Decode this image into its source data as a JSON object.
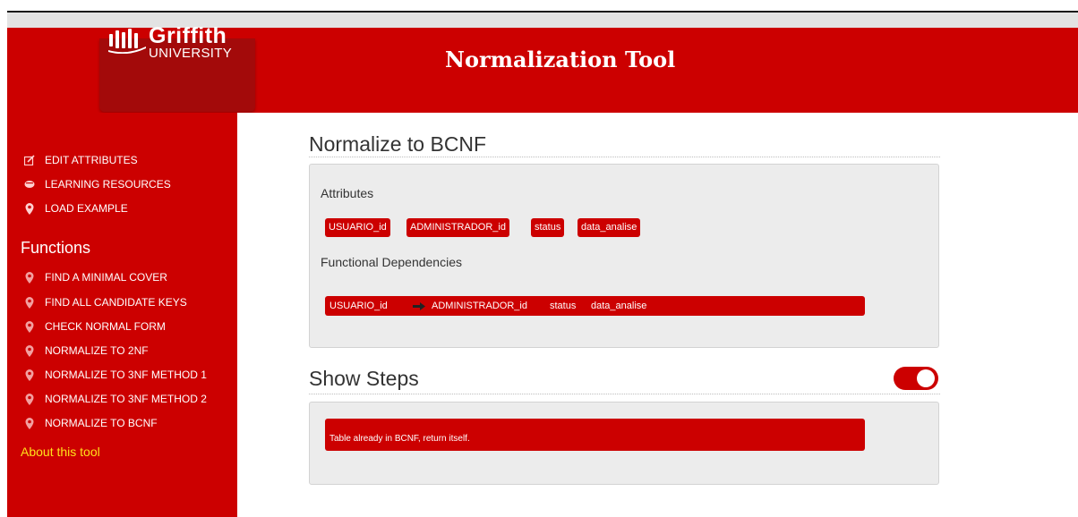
{
  "brand": {
    "logo_word": "Griffith",
    "logo_sub": "UNIVERSITY"
  },
  "header": {
    "title": "Normalization Tool"
  },
  "sidebar": {
    "top_items": [
      {
        "label": "EDIT ATTRIBUTES",
        "icon": "edit-icon"
      },
      {
        "label": "LEARNING RESOURCES",
        "icon": "book-icon"
      },
      {
        "label": "LOAD EXAMPLE",
        "icon": "pin-icon"
      }
    ],
    "functions_title": "Functions",
    "functions": [
      {
        "label": "FIND A MINIMAL COVER",
        "icon": "pin-icon"
      },
      {
        "label": "FIND ALL CANDIDATE KEYS",
        "icon": "pin-icon"
      },
      {
        "label": "CHECK NORMAL FORM",
        "icon": "pin-icon"
      },
      {
        "label": "NORMALIZE TO 2NF",
        "icon": "pin-icon"
      },
      {
        "label": "NORMALIZE TO 3NF METHOD 1",
        "icon": "pin-icon"
      },
      {
        "label": "NORMALIZE TO 3NF METHOD 2",
        "icon": "pin-icon"
      },
      {
        "label": "NORMALIZE TO BCNF",
        "icon": "pin-icon"
      }
    ],
    "about": "About this tool"
  },
  "main": {
    "section_title": "Normalize to BCNF",
    "attributes_label": "Attributes",
    "attributes": [
      "USUARIO_id",
      "ADMINISTRADOR_id",
      "status",
      "data_analise"
    ],
    "fd_label": "Functional Dependencies",
    "fd": {
      "lhs": "USUARIO_id",
      "rhs": [
        "ADMINISTRADOR_id",
        "status",
        "data_analise"
      ]
    },
    "steps_title": "Show Steps",
    "steps_toggle_on": true,
    "steps": [
      "Table already in BCNF, return itself."
    ]
  },
  "colors": {
    "accent": "#cc0000",
    "link": "#ffe11a",
    "panel": "#ececec"
  }
}
